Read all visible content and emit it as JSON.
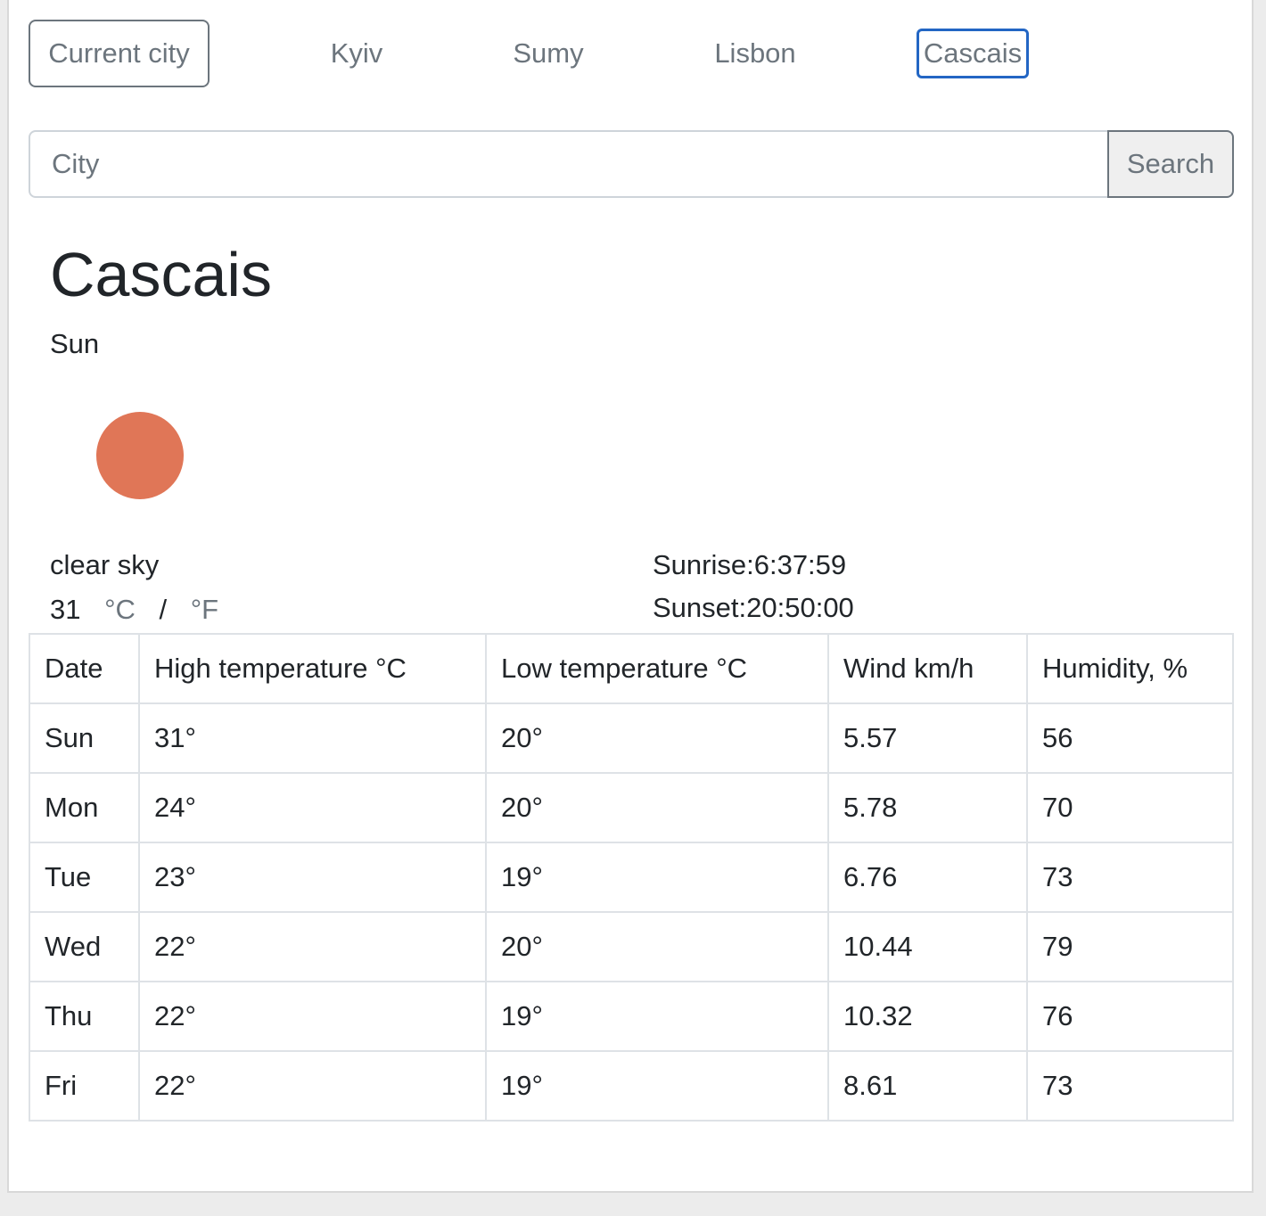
{
  "city_tabs": [
    {
      "label": "Current city"
    },
    {
      "label": "Kyiv"
    },
    {
      "label": "Sumy"
    },
    {
      "label": "Lisbon"
    },
    {
      "label": "Cascais"
    }
  ],
  "search": {
    "placeholder": "City",
    "button_label": "Search"
  },
  "current": {
    "city": "Cascais",
    "weekday": "Sun",
    "icon": "sun-icon",
    "icon_color": "#e07657",
    "description": "clear sky",
    "temperature": "31",
    "unit_c": "°C",
    "unit_sep": "/",
    "unit_f": "°F",
    "sunrise": "Sunrise:6:37:59",
    "sunset": "Sunset:20:50:00"
  },
  "forecast": {
    "headers": [
      "Date",
      "High temperature °C",
      "Low temperature °C",
      "Wind km/h",
      "Humidity, %"
    ],
    "rows": [
      [
        "Sun",
        "31°",
        "20°",
        "5.57",
        "56"
      ],
      [
        "Mon",
        "24°",
        "20°",
        "5.78",
        "70"
      ],
      [
        "Tue",
        "23°",
        "19°",
        "6.76",
        "73"
      ],
      [
        "Wed",
        "22°",
        "20°",
        "10.44",
        "79"
      ],
      [
        "Thu",
        "22°",
        "19°",
        "10.32",
        "76"
      ],
      [
        "Fri",
        "22°",
        "19°",
        "8.61",
        "73"
      ]
    ]
  },
  "colors": {
    "active_tab_border": "#2366c4",
    "sun": "#e07657"
  }
}
